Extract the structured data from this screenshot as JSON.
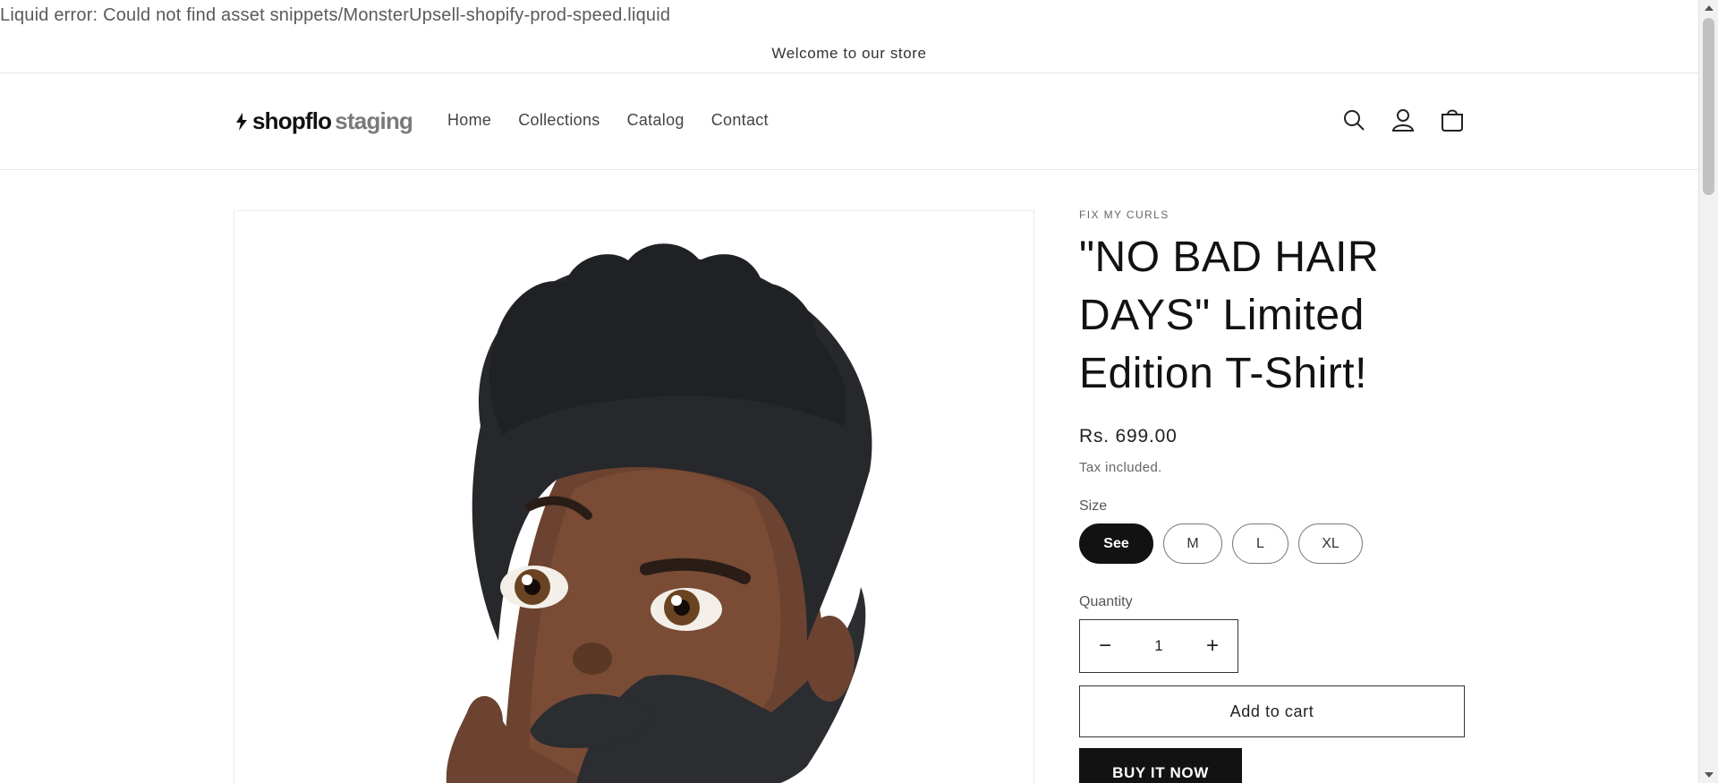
{
  "error_banner": "Liquid error: Could not find asset snippets/MonsterUpsell-shopify-prod-speed.liquid",
  "announcement": "Welcome to our store",
  "header": {
    "logo_bold": "shopflo",
    "logo_light": "staging",
    "nav": [
      "Home",
      "Collections",
      "Catalog",
      "Contact"
    ],
    "icons": [
      "search-icon",
      "account-icon",
      "cart-icon"
    ]
  },
  "product": {
    "vendor": "FIX MY CURLS",
    "title_lines": [
      "\"NO BAD HAIR",
      "DAYS\" Limited",
      "Edition T-Shirt!"
    ],
    "price": "Rs. 699.00",
    "tax_note": "Tax included.",
    "size_label": "Size",
    "sizes": [
      "See",
      "M",
      "L",
      "XL"
    ],
    "selected_size": "See",
    "quantity_label": "Quantity",
    "quantity_value": "1",
    "decrease": "−",
    "increase": "+",
    "add_to_cart": "Add to cart",
    "buy_now": "BUY IT NOW"
  },
  "colors": {
    "text": "#121212",
    "button_dark": "#121212",
    "border": "#e6e6e6"
  }
}
